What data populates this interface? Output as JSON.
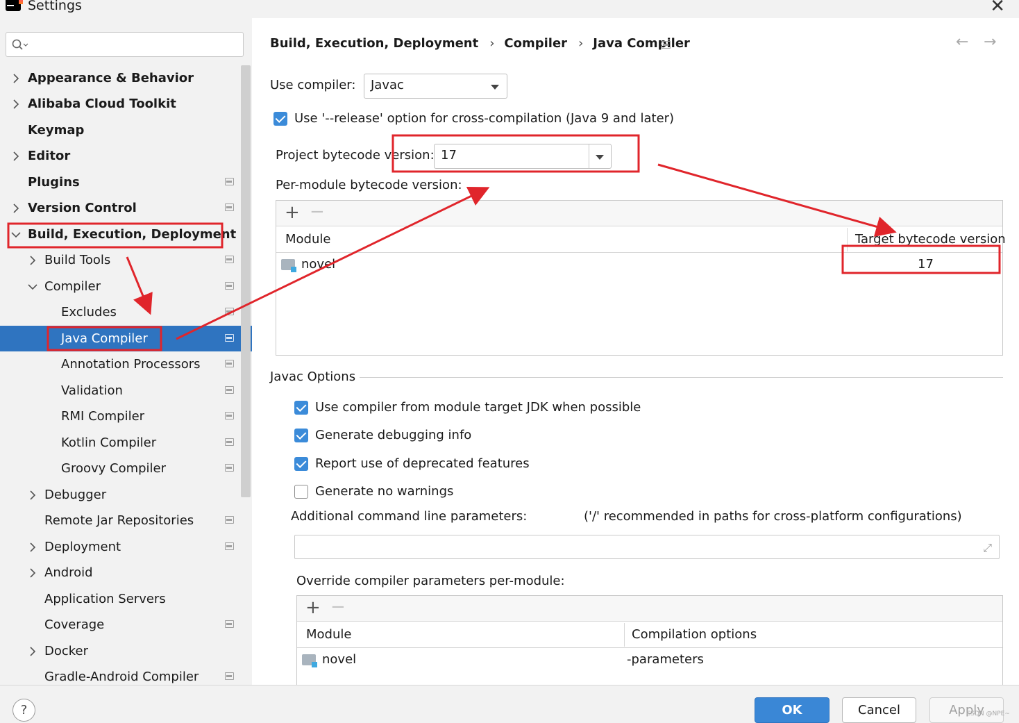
{
  "window": {
    "title": "Settings"
  },
  "search": {
    "placeholder": ""
  },
  "sidebar": {
    "items": [
      {
        "label": "Appearance & Behavior",
        "chevron": "right"
      },
      {
        "label": "Alibaba Cloud Toolkit",
        "chevron": "right"
      },
      {
        "label": "Keymap",
        "chevron": ""
      },
      {
        "label": "Editor",
        "chevron": "right"
      },
      {
        "label": "Plugins",
        "chevron": ""
      },
      {
        "label": "Version Control",
        "chevron": "right"
      },
      {
        "label": "Build, Execution, Deployment",
        "chevron": "down"
      },
      {
        "label": "Build Tools",
        "chevron": "right"
      },
      {
        "label": "Compiler",
        "chevron": "down"
      },
      {
        "label": "Excludes",
        "chevron": ""
      },
      {
        "label": "Java Compiler",
        "chevron": ""
      },
      {
        "label": "Annotation Processors",
        "chevron": ""
      },
      {
        "label": "Validation",
        "chevron": ""
      },
      {
        "label": "RMI Compiler",
        "chevron": ""
      },
      {
        "label": "Kotlin Compiler",
        "chevron": ""
      },
      {
        "label": "Groovy Compiler",
        "chevron": ""
      },
      {
        "label": "Debugger",
        "chevron": "right"
      },
      {
        "label": "Remote Jar Repositories",
        "chevron": ""
      },
      {
        "label": "Deployment",
        "chevron": "right"
      },
      {
        "label": "Android",
        "chevron": "right"
      },
      {
        "label": "Application Servers",
        "chevron": ""
      },
      {
        "label": "Coverage",
        "chevron": ""
      },
      {
        "label": "Docker",
        "chevron": "right"
      },
      {
        "label": "Gradle-Android Compiler",
        "chevron": ""
      }
    ]
  },
  "breadcrumb": [
    "Build, Execution, Deployment",
    "Compiler",
    "Java Compiler"
  ],
  "compiler": {
    "use_compiler_label": "Use compiler:",
    "use_compiler_value": "Javac",
    "release_option_label": "Use '--release' option for cross-compilation (Java 9 and later)",
    "release_option_checked": true,
    "project_bytecode_label": "Project bytecode version:",
    "project_bytecode_value": "17",
    "per_module_label": "Per-module bytecode version:",
    "per_module_table": {
      "columns": [
        "Module",
        "Target bytecode version"
      ],
      "rows": [
        {
          "module": "novel",
          "version": "17"
        }
      ]
    }
  },
  "javac": {
    "section_title": "Javac Options",
    "options": [
      {
        "label": "Use compiler from module target JDK when possible",
        "checked": true
      },
      {
        "label": "Generate debugging info",
        "checked": true
      },
      {
        "label": "Report use of deprecated features",
        "checked": true
      },
      {
        "label": "Generate no warnings",
        "checked": false
      }
    ],
    "additional_params_label": "Additional command line parameters:",
    "additional_params_hint": "('/' recommended in paths for cross-platform configurations)",
    "additional_params_value": "",
    "override_label": "Override compiler parameters per-module:",
    "override_table": {
      "columns": [
        "Module",
        "Compilation options"
      ],
      "rows": [
        {
          "module": "novel",
          "options": "-parameters"
        }
      ]
    }
  },
  "footer": {
    "help": "?",
    "ok": "OK",
    "cancel": "Cancel",
    "apply": "Apply",
    "watermark": "CSDN @NPE~"
  },
  "colors": {
    "accent": "#2f74c0",
    "annotation": "#e0252b",
    "ok_button": "#3a87d6"
  }
}
